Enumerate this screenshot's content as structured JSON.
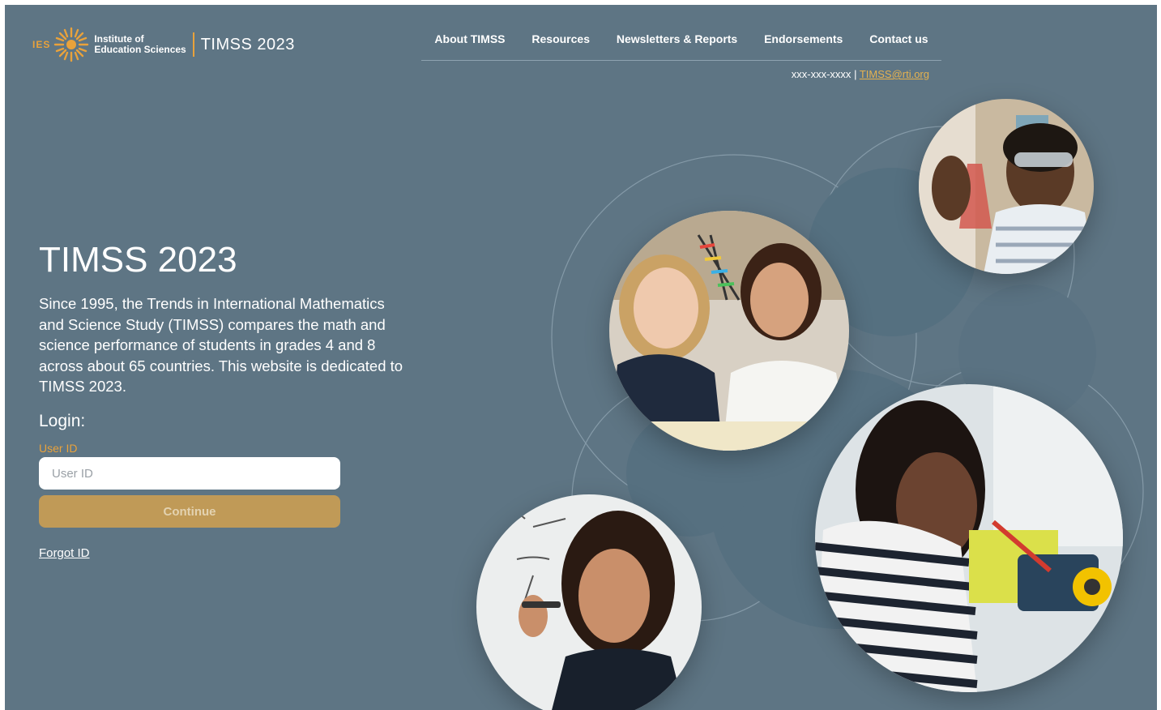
{
  "header": {
    "ies": "IES",
    "institute_line1": "Institute of",
    "institute_line2": "Education Sciences",
    "brand": "TIMSS 2023",
    "nav": [
      {
        "label": "About TIMSS"
      },
      {
        "label": "Resources"
      },
      {
        "label": "Newsletters & Reports"
      },
      {
        "label": "Endorsements"
      },
      {
        "label": "Contact us"
      }
    ],
    "phone": "xxx-xxx-xxxx",
    "separator": "|",
    "email": "TIMSS@rti.org"
  },
  "main": {
    "title": "TIMSS 2023",
    "description": "Since 1995, the Trends in International Mathematics and Science Study (TIMSS) compares the math and science performance of students in grades 4 and 8 across about 65 countries. This website is dedicated to TIMSS 2023.",
    "login_heading": "Login:",
    "userid_label": "User ID",
    "userid_placeholder": "User ID",
    "userid_value": "",
    "continue_label": "Continue",
    "forgot_label": "Forgot ID"
  },
  "colors": {
    "background": "#5e7584",
    "accent": "#e9a23b",
    "button": "#c09a57"
  },
  "icons": [
    "sunburst-logo-icon"
  ]
}
